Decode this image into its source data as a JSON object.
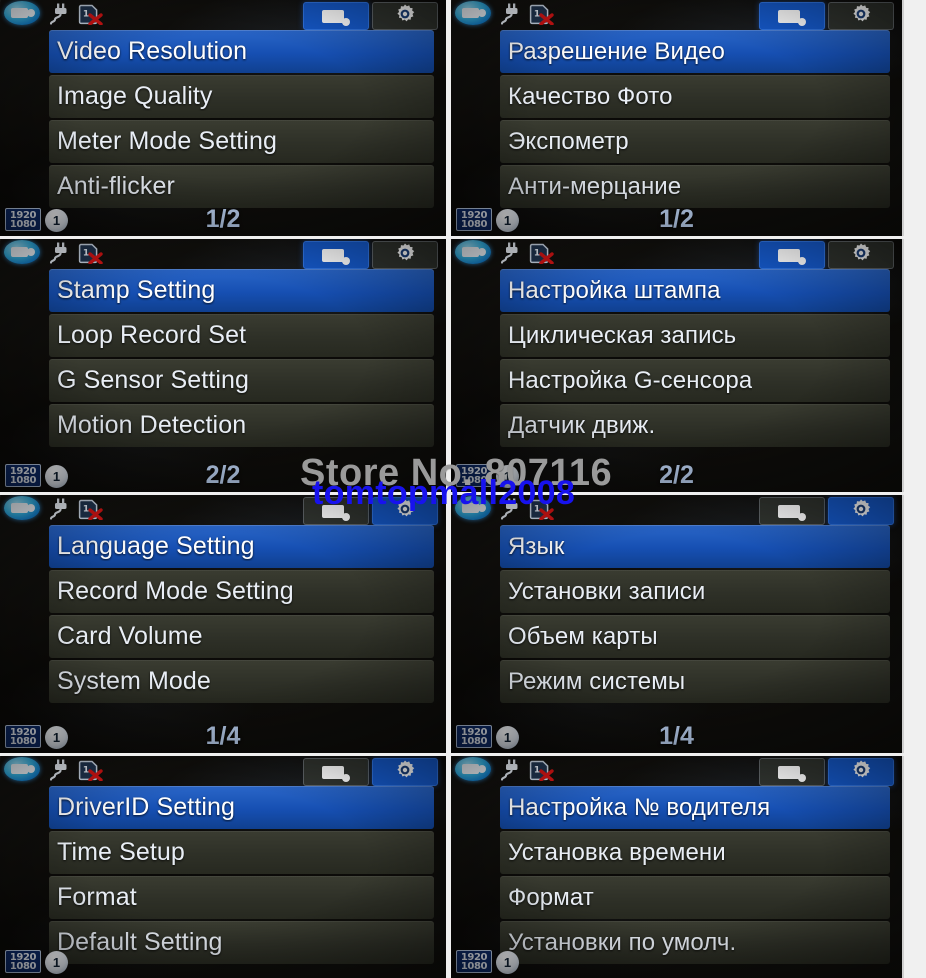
{
  "meta": {
    "device": "dash-camera-osd-menu",
    "watermark_primary": "Store No. 807116",
    "watermark_secondary": "tomtopmall2008"
  },
  "status_icons": {
    "camera_badge": "video-camera-badge-icon",
    "power": "power-plug-icon",
    "card": "sd-card-missing-icon"
  },
  "footer_icons": {
    "resolution_top": "1920",
    "resolution_bottom": "1080",
    "loop_label": "1"
  },
  "tabs": {
    "video_label": "video-tab",
    "settings_label": "settings-tab"
  },
  "panels": [
    {
      "id": "video-menu-p1-en",
      "language": "English",
      "active_tab": "video",
      "page": "1/2",
      "items": [
        {
          "label": "Video Resolution",
          "selected": true
        },
        {
          "label": "Image Quality",
          "selected": false
        },
        {
          "label": "Meter Mode Setting",
          "selected": false
        },
        {
          "label": "Anti-flicker",
          "selected": false
        }
      ]
    },
    {
      "id": "video-menu-p1-ru",
      "language": "Russian",
      "active_tab": "video",
      "page": "1/2",
      "items": [
        {
          "label": "Разрешение Видео",
          "selected": true
        },
        {
          "label": "Качество Фото",
          "selected": false
        },
        {
          "label": "Экспометр",
          "selected": false
        },
        {
          "label": "Анти-мерцание",
          "selected": false
        }
      ]
    },
    {
      "id": "video-menu-p2-en",
      "language": "English",
      "active_tab": "video",
      "page": "2/2",
      "items": [
        {
          "label": "Stamp Setting",
          "selected": true
        },
        {
          "label": "Loop Record Set",
          "selected": false
        },
        {
          "label": "G Sensor Setting",
          "selected": false
        },
        {
          "label": "Motion Detection",
          "selected": false
        }
      ]
    },
    {
      "id": "video-menu-p2-ru",
      "language": "Russian",
      "active_tab": "video",
      "page": "2/2",
      "items": [
        {
          "label": "Настройка штампа",
          "selected": true
        },
        {
          "label": "Циклическая запись",
          "selected": false
        },
        {
          "label": "Настройка G-сенсора",
          "selected": false
        },
        {
          "label": "Датчик движ.",
          "selected": false
        }
      ]
    },
    {
      "id": "system-menu-p1-en",
      "language": "English",
      "active_tab": "settings",
      "page": "1/4",
      "items": [
        {
          "label": "Language Setting",
          "selected": true
        },
        {
          "label": "Record Mode Setting",
          "selected": false
        },
        {
          "label": "Card Volume",
          "selected": false
        },
        {
          "label": "System Mode",
          "selected": false
        }
      ]
    },
    {
      "id": "system-menu-p1-ru",
      "language": "Russian",
      "active_tab": "settings",
      "page": "1/4",
      "items": [
        {
          "label": "Язык",
          "selected": true
        },
        {
          "label": "Установки записи",
          "selected": false
        },
        {
          "label": "Объем карты",
          "selected": false
        },
        {
          "label": "Режим системы",
          "selected": false
        }
      ]
    },
    {
      "id": "system-menu-p2-en",
      "language": "English",
      "active_tab": "settings",
      "page": "",
      "items": [
        {
          "label": "DriverID Setting",
          "selected": true
        },
        {
          "label": "Time Setup",
          "selected": false
        },
        {
          "label": "Format",
          "selected": false
        },
        {
          "label": "Default Setting",
          "selected": false
        }
      ]
    },
    {
      "id": "system-menu-p2-ru",
      "language": "Russian",
      "active_tab": "settings",
      "page": "",
      "items": [
        {
          "label": "Настройка № водителя",
          "selected": true
        },
        {
          "label": "Установка времени",
          "selected": false
        },
        {
          "label": "Формат",
          "selected": false
        },
        {
          "label": "Установки по умолч.",
          "selected": false
        }
      ]
    }
  ],
  "colors": {
    "selected_blue": "#164fb2",
    "tab_active_blue": "#1558c8",
    "row_olive": "#2e3027",
    "page_text": "#bcd2f2",
    "watermark_blue": "#1712ee"
  }
}
